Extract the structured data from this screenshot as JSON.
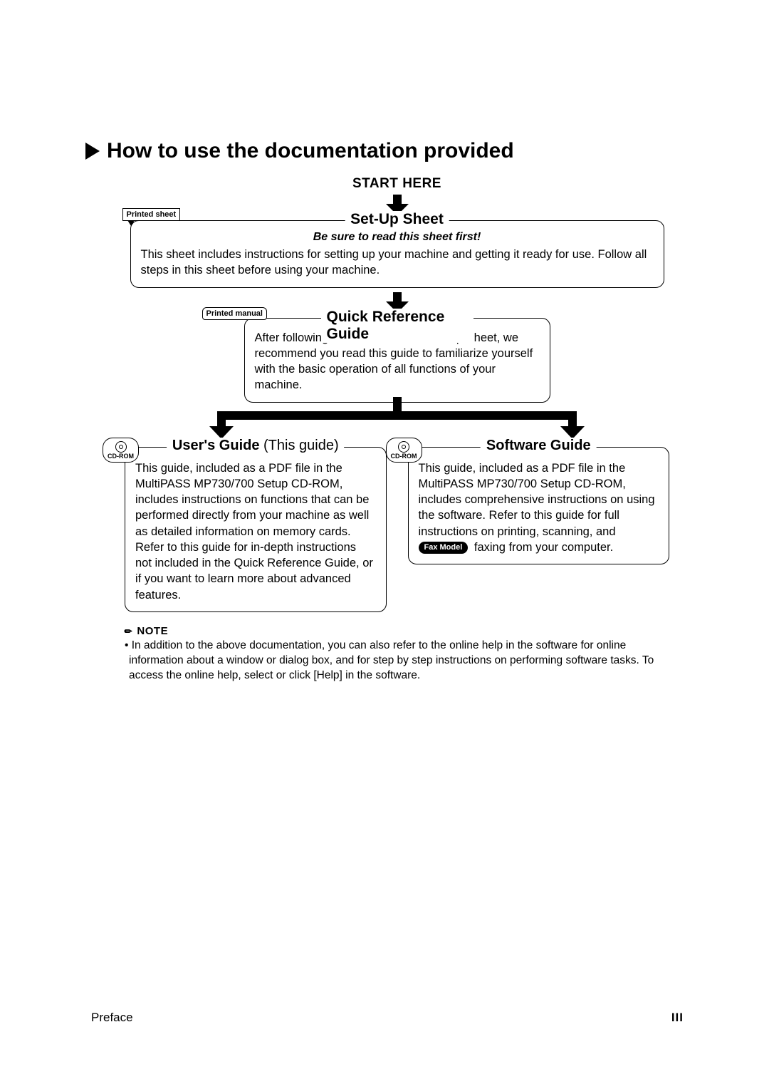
{
  "heading": "How to use the documentation provided",
  "start_here": "START HERE",
  "setup": {
    "tag": "Printed sheet",
    "title": "Set-Up Sheet",
    "subtitle": "Be sure to read this sheet first!",
    "body": "This sheet includes instructions for setting up your machine and getting it ready for use. Follow all steps in this sheet before using your machine."
  },
  "qrg": {
    "tag": "Printed manual",
    "title": "Quick Reference Guide",
    "body": "After following instructions in the Set-Up Sheet, we recommend you read this guide to familiarize yourself with the basic operation of all functions of your machine."
  },
  "users": {
    "tag": "CD-ROM",
    "title_bold": "User's Guide",
    "title_thin": " (This guide)",
    "body": "This guide, included as a PDF file in the MultiPASS MP730/700 Setup CD-ROM, includes instructions on functions that can be performed directly from your machine as well as detailed information on memory cards. Refer to this guide for in-depth instructions not included in the Quick Reference Guide, or if you want to learn more about advanced features."
  },
  "software": {
    "tag": "CD-ROM",
    "title": "Software Guide",
    "body_pre": "This guide, included as a PDF file in the MultiPASS MP730/700 Setup CD-ROM, includes comprehensive instructions on using the software. Refer to this guide for full instructions on printing, scanning, and ",
    "fax_badge": "Fax Model",
    "body_post": " faxing from your computer."
  },
  "note": {
    "label": "NOTE",
    "body": "• In addition to the above documentation, you can also refer to the online help in the software for online information about a window or dialog box, and for step by step instructions on performing software tasks. To access the online help, select or click [Help] in the software."
  },
  "footer": {
    "section": "Preface",
    "page": "III"
  }
}
